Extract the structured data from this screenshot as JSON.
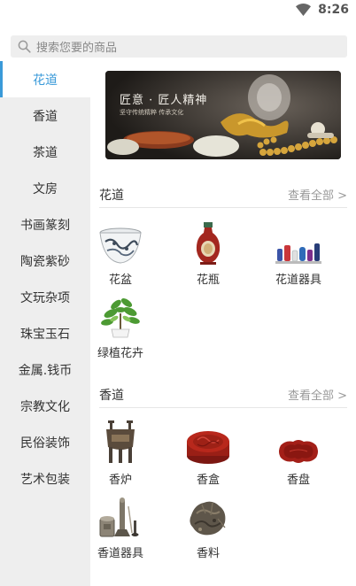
{
  "status": {
    "time": "8:26"
  },
  "search": {
    "placeholder": "搜索您要的商品"
  },
  "sidebar": {
    "items": [
      {
        "label": "花道"
      },
      {
        "label": "香道"
      },
      {
        "label": "茶道"
      },
      {
        "label": "文房"
      },
      {
        "label": "书画篆刻"
      },
      {
        "label": "陶瓷紫砂"
      },
      {
        "label": "文玩杂项"
      },
      {
        "label": "珠宝玉石"
      },
      {
        "label": "金属.钱币"
      },
      {
        "label": "宗教文化"
      },
      {
        "label": "民俗装饰"
      },
      {
        "label": "艺术包装"
      }
    ],
    "active_index": 0
  },
  "banner": {
    "title": "匠意 · 匠人精神",
    "subtitle": "坚守传统精粹 传承文化"
  },
  "sections": [
    {
      "title": "花道",
      "more": "查看全部 >",
      "items": [
        {
          "label": "花盆",
          "icon": "flower-pot-icon"
        },
        {
          "label": "花瓶",
          "icon": "vase-icon"
        },
        {
          "label": "花道器具",
          "icon": "flower-tools-icon"
        },
        {
          "label": "绿植花卉",
          "icon": "green-plant-icon"
        }
      ]
    },
    {
      "title": "香道",
      "more": "查看全部 >",
      "items": [
        {
          "label": "香炉",
          "icon": "incense-burner-icon"
        },
        {
          "label": "香盒",
          "icon": "incense-box-icon"
        },
        {
          "label": "香盘",
          "icon": "incense-plate-icon"
        },
        {
          "label": "香道器具",
          "icon": "incense-tools-icon"
        },
        {
          "label": "香料",
          "icon": "spice-icon"
        }
      ]
    }
  ],
  "colors": {
    "accent": "#3a9ad9",
    "sidebar_bg": "#eeeeee",
    "text": "#333333",
    "muted": "#999999"
  }
}
